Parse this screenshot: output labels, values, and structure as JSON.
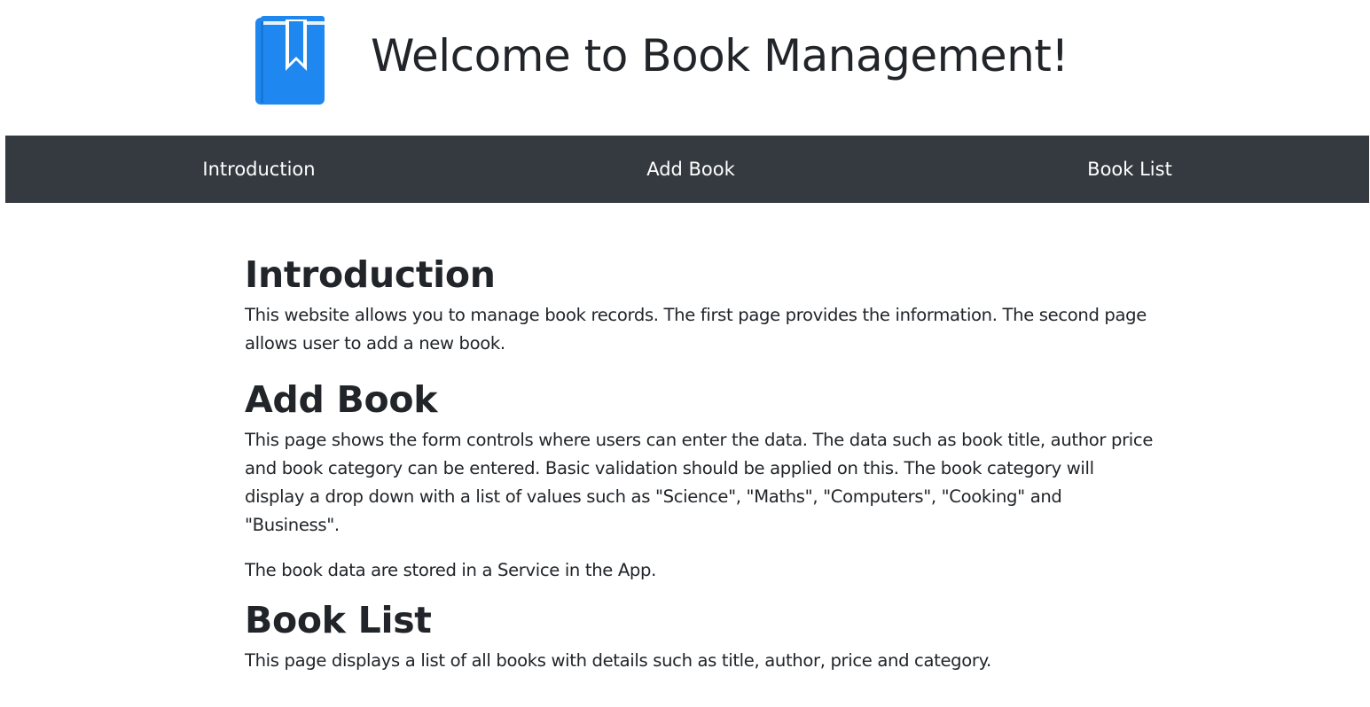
{
  "header": {
    "title": "Welcome to Book Management!",
    "logo_icon": "book-bookmark-icon",
    "logo_color": "#1e88f0"
  },
  "nav": {
    "background": "#343a40",
    "items": [
      {
        "label": "Introduction"
      },
      {
        "label": "Add Book"
      },
      {
        "label": "Book List"
      }
    ]
  },
  "sections": {
    "introduction": {
      "heading": "Introduction",
      "paragraphs": [
        "This website allows you to manage book records. The first page provides the information. The second page allows user to add a new book."
      ]
    },
    "add_book": {
      "heading": "Add Book",
      "paragraphs": [
        "This page shows the form controls where users can enter the data. The data such as book title, author price and book category can be entered. Basic validation should be applied on this. The book category will display a drop down with a list of values such as \"Science\", \"Maths\", \"Computers\", \"Cooking\" and \"Business\".",
        "The book data are stored in a Service in the App."
      ]
    },
    "book_list": {
      "heading": "Book List",
      "paragraphs": [
        "This page displays a list of all books with details such as title, author, price and category."
      ]
    }
  }
}
